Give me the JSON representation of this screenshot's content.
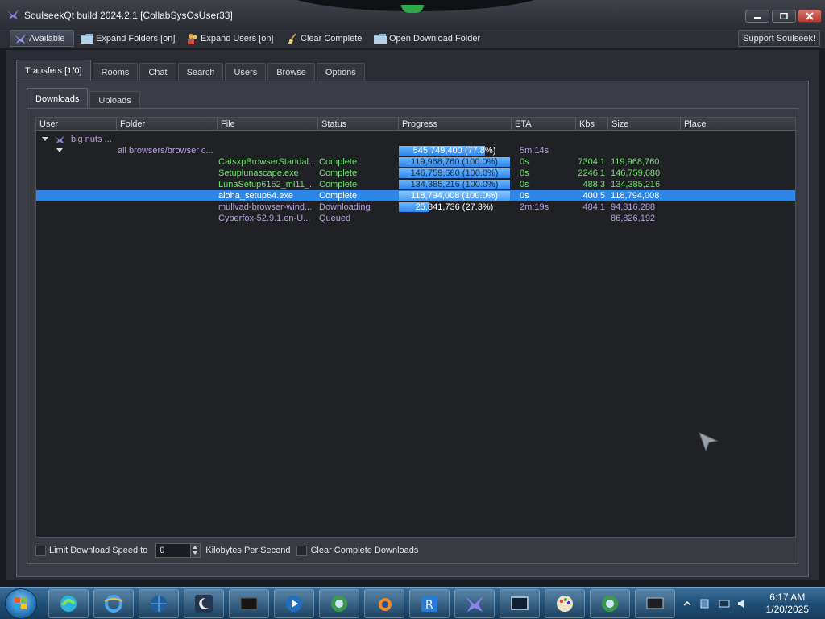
{
  "window": {
    "title": "SoulseekQt build 2024.2.1 [CollabSysOsUser33]"
  },
  "toolbar": {
    "available_label": "Available",
    "expand_folders_label": "Expand Folders [on]",
    "expand_users_label": "Expand Users [on]",
    "clear_complete_label": "Clear Complete",
    "open_download_folder_label": "Open Download Folder",
    "support_label": "Support Soulseek!"
  },
  "tabs": {
    "main": [
      "Transfers [1/0]",
      "Rooms",
      "Chat",
      "Search",
      "Users",
      "Browse",
      "Options"
    ],
    "active_main": "Transfers [1/0]",
    "sub": [
      "Downloads",
      "Uploads"
    ],
    "active_sub": "Downloads"
  },
  "table": {
    "headers": [
      "User",
      "Folder",
      "File",
      "Status",
      "Progress",
      "ETA",
      "Kbs",
      "Size",
      "Place"
    ],
    "user_group": {
      "user": "big nuts ...",
      "folder": "all browsers/browser c...",
      "progress_text": "545,749,400 (77.8%)",
      "progress_fraction": 0.778,
      "eta": "5m:14s"
    },
    "rows": [
      {
        "file": "CatsxpBrowserStandal...",
        "status": "Complete",
        "progress_text": "119,968,760 (100.0%)",
        "progress_fraction": 1.0,
        "eta": "0s",
        "kbs": "7304.1",
        "size": "119,968,760",
        "state": "complete",
        "selected": false
      },
      {
        "file": "Setuplunascape.exe",
        "status": "Complete",
        "progress_text": "146,759,680 (100.0%)",
        "progress_fraction": 1.0,
        "eta": "0s",
        "kbs": "2246.1",
        "size": "146,759,680",
        "state": "complete",
        "selected": false
      },
      {
        "file": "LunaSetup6152_ml11_...",
        "status": "Complete",
        "progress_text": "134,385,216 (100.0%)",
        "progress_fraction": 1.0,
        "eta": "0s",
        "kbs": "488.3",
        "size": "134,385,216",
        "state": "complete",
        "selected": false
      },
      {
        "file": "aloha_setup64.exe",
        "status": "Complete",
        "progress_text": "118,794,008 (100.0%)",
        "progress_fraction": 1.0,
        "eta": "0s",
        "kbs": "400.5",
        "size": "118,794,008",
        "state": "complete",
        "selected": true
      },
      {
        "file": "mullvad-browser-wind...",
        "status": "Downloading",
        "progress_text": "25,841,736 (27.3%)",
        "progress_fraction": 0.273,
        "eta": "2m:19s",
        "kbs": "484.1",
        "size": "94,816,288",
        "state": "pending",
        "selected": false
      },
      {
        "file": "Cyberfox-52.9.1.en-U...",
        "status": "Queued",
        "progress_text": "",
        "progress_fraction": null,
        "eta": "",
        "kbs": "",
        "size": "86,826,192",
        "state": "pending",
        "selected": false
      }
    ]
  },
  "options": {
    "limit_speed_label": "Limit Download Speed to",
    "speed_value": "0",
    "speed_unit_label": "Kilobytes Per Second",
    "clear_complete_downloads_label": "Clear Complete Downloads"
  },
  "taskbar": {
    "time": "6:17 AM",
    "date": "1/20/2025",
    "apps": [
      "edge-icon",
      "internet-explorer-icon",
      "globe-icon",
      "moon-icon",
      "terminal-icon",
      "media-player-icon",
      "browser-icon",
      "blender-icon",
      "regex-icon",
      "soulseek-icon",
      "monitor-icon",
      "paint-icon",
      "browser-icon",
      "screen-icon"
    ]
  },
  "colors": {
    "complete": "#6fe06a",
    "pending": "#b79fe0",
    "selection": "#2e86e6",
    "progress": "#3d97f0"
  }
}
